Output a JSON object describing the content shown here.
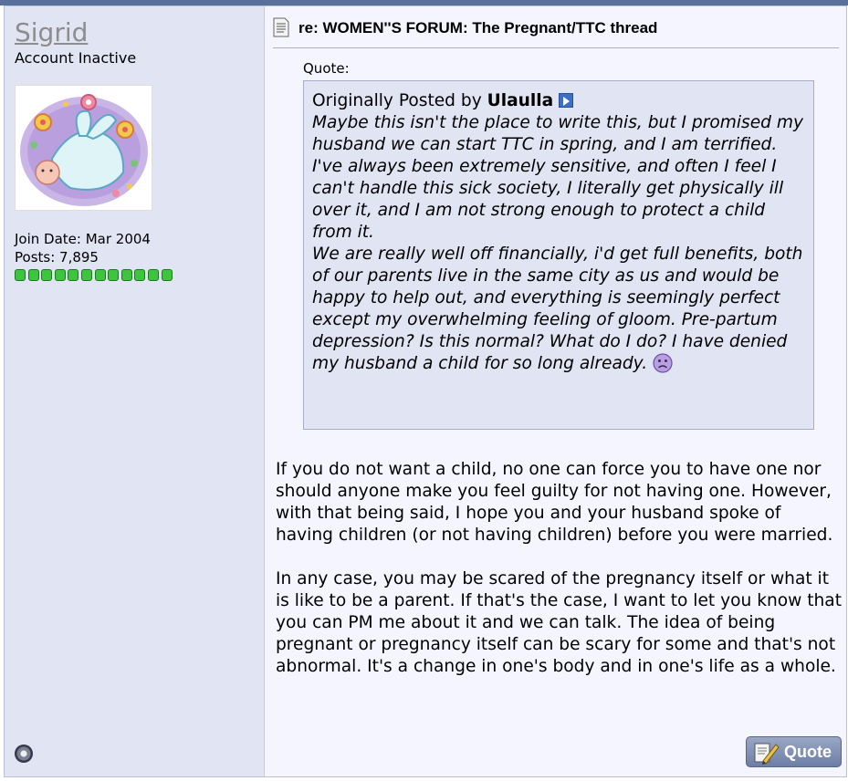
{
  "post": {
    "author": {
      "name": "Sigrid",
      "title": "Account Inactive",
      "join_date": "Join Date: Mar 2004",
      "posts": "Posts: 7,895",
      "reputation_pips": 12
    },
    "title": "re: WOMEN''S FORUM: The Pregnant/TTC thread",
    "quote": {
      "label": "Quote:",
      "originally_posted_by": "Originally Posted by",
      "quoted_author": "Ulaulla",
      "message": "Maybe this isn't the place to write this, but I promised my husband we can start TTC in spring, and I am terrified.\nI've always been extremely sensitive, and often I feel I can't handle this sick society, I literally get physically ill over it, and I am not strong enough to protect a child from it.\nWe are really well off financially, i'd get full benefits, both of our parents live in the same city as us and would be happy to help out, and everything is seemingly perfect except my overwhelming feeling of gloom. Pre-partum depression? Is this normal? What do I do? I have denied my husband a child for so long already."
    },
    "body": [
      "If you do not want a child, no one can force you to have one nor should anyone make you feel guilty for not having one. However, with that being said, I hope you and your husband spoke of having children (or not having children) before you were married.",
      "In any case, you may be scared of the pregnancy itself or what it is like to be a parent. If that's the case, I want to let you know that you can PM me about it and we can talk. The idea of being pregnant or pregnancy itself can be scary for some and that's not abnormal. It's a change in one's body and in one's life as a whole."
    ],
    "quote_button_label": "Quote"
  }
}
